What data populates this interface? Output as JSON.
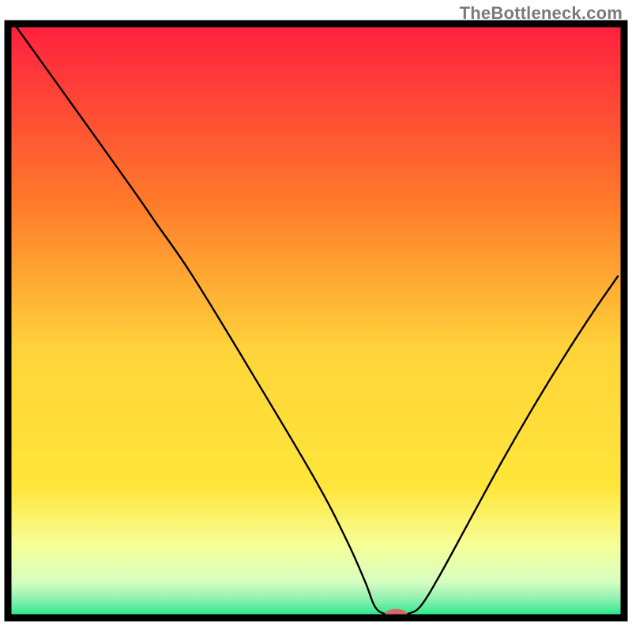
{
  "attribution": "TheBottleneck.com",
  "chart_data": {
    "type": "line",
    "title": "",
    "xlabel": "",
    "ylabel": "",
    "x_range": [
      0,
      100
    ],
    "y_range_percent": [
      0,
      100
    ],
    "gradient_colors": {
      "top": "#ff1f3f",
      "upper_mid": "#ffb23a",
      "mid": "#ffe63a",
      "lower_mid": "#f1ff8a",
      "lower": "#c8ffb4",
      "bottom": "#17e884"
    },
    "frame_color": "#000000",
    "curve": {
      "name": "bottleneck-curve",
      "note": "y is percentage of plot height from bottom (0=bottom green band, 100=top). Estimated from pixels.",
      "points": [
        {
          "x": 1.0,
          "y": 100.0
        },
        {
          "x": 10.0,
          "y": 87.0
        },
        {
          "x": 20.0,
          "y": 72.5
        },
        {
          "x": 24.0,
          "y": 66.5
        },
        {
          "x": 30.0,
          "y": 57.5
        },
        {
          "x": 40.0,
          "y": 40.5
        },
        {
          "x": 50.0,
          "y": 23.0
        },
        {
          "x": 55.0,
          "y": 13.0
        },
        {
          "x": 58.0,
          "y": 6.0
        },
        {
          "x": 59.5,
          "y": 2.0
        },
        {
          "x": 61.0,
          "y": 0.7
        },
        {
          "x": 63.0,
          "y": 0.4
        },
        {
          "x": 65.0,
          "y": 0.7
        },
        {
          "x": 67.0,
          "y": 2.0
        },
        {
          "x": 70.0,
          "y": 7.0
        },
        {
          "x": 75.0,
          "y": 16.5
        },
        {
          "x": 80.0,
          "y": 26.0
        },
        {
          "x": 85.0,
          "y": 35.0
        },
        {
          "x": 90.0,
          "y": 43.5
        },
        {
          "x": 95.0,
          "y": 51.5
        },
        {
          "x": 99.0,
          "y": 57.5
        }
      ]
    },
    "marker": {
      "x": 63.0,
      "y": 0.6,
      "color": "#d66a6a",
      "rx_pct": 1.8,
      "ry_pct": 0.9
    }
  }
}
